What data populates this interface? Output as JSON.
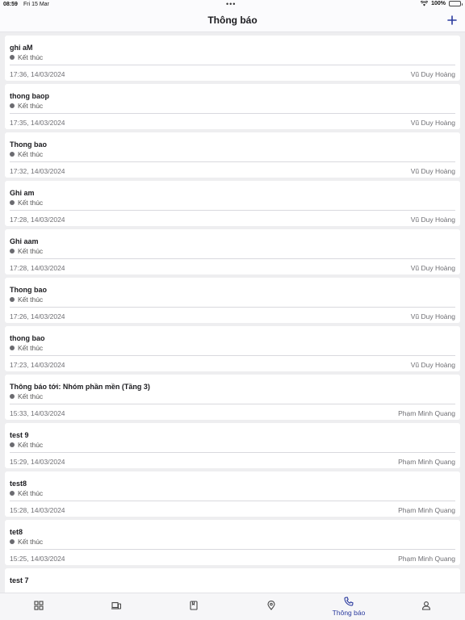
{
  "status_bar": {
    "time": "08:59",
    "date": "Fri 15 Mar",
    "battery": "100%"
  },
  "header": {
    "title": "Thông báo",
    "add_icon": "plus-icon",
    "accent_color": "#2a3a9e"
  },
  "notifications": [
    {
      "title": "ghi aM",
      "status": "Kết thúc",
      "time": "17:36, 14/03/2024",
      "author": "Vũ Duy Hoàng"
    },
    {
      "title": "thong baop",
      "status": "Kết thúc",
      "time": "17:35, 14/03/2024",
      "author": "Vũ Duy Hoàng"
    },
    {
      "title": "Thong bao",
      "status": "Kết thúc",
      "time": "17:32, 14/03/2024",
      "author": "Vũ Duy Hoàng"
    },
    {
      "title": "Ghi am",
      "status": "Kết thúc",
      "time": "17:28, 14/03/2024",
      "author": "Vũ Duy Hoàng"
    },
    {
      "title": "Ghi aam",
      "status": "Kết thúc",
      "time": "17:28, 14/03/2024",
      "author": "Vũ Duy Hoàng"
    },
    {
      "title": "Thong bao",
      "status": "Kết thúc",
      "time": "17:26, 14/03/2024",
      "author": "Vũ Duy Hoàng"
    },
    {
      "title": "thong bao",
      "status": "Kết thúc",
      "time": "17:23, 14/03/2024",
      "author": "Vũ Duy Hoàng"
    },
    {
      "title": "Thông báo tới:  Nhóm phần mền (Tầng 3)",
      "status": "Kết thúc",
      "time": "15:33, 14/03/2024",
      "author": "Phạm Minh Quang"
    },
    {
      "title": "test 9",
      "status": "Kết thúc",
      "time": "15:29, 14/03/2024",
      "author": "Phạm Minh Quang"
    },
    {
      "title": "test8",
      "status": "Kết thúc",
      "time": "15:28, 14/03/2024",
      "author": "Phạm Minh Quang"
    },
    {
      "title": "tet8",
      "status": "Kết thúc",
      "time": "15:25, 14/03/2024",
      "author": "Phạm Minh Quang"
    },
    {
      "title": "test 7",
      "status": "",
      "time": "",
      "author": ""
    }
  ],
  "tab_bar": {
    "tabs": [
      {
        "icon": "dashboard-icon",
        "label": ""
      },
      {
        "icon": "devices-icon",
        "label": ""
      },
      {
        "icon": "book-icon",
        "label": ""
      },
      {
        "icon": "location-pin-icon",
        "label": ""
      },
      {
        "icon": "phone-icon",
        "label": "Thông báo"
      },
      {
        "icon": "user-icon",
        "label": ""
      }
    ]
  }
}
